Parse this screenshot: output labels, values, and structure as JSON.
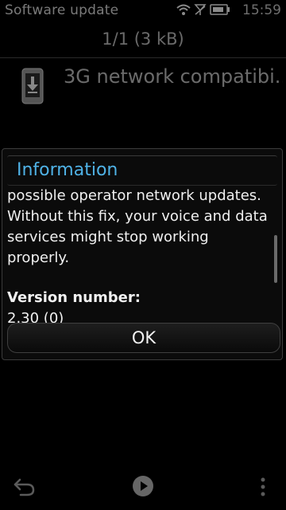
{
  "statusbar": {
    "title": "Software update",
    "time": "15:59",
    "icons": [
      "wifi-icon",
      "signal-off-icon",
      "battery-icon"
    ]
  },
  "header": {
    "title": "1/1 (3 kB)"
  },
  "list": {
    "items": [
      {
        "label": "3G network compatibi...",
        "icon": "download-phone-icon"
      }
    ]
  },
  "dialog": {
    "title": "Information",
    "body_lines": [
      "possible operator network updates.",
      "Without this fix, your voice and data",
      "services might stop working properly."
    ],
    "version_label": "Version number:",
    "version_value": "2.30 (0)",
    "ok_label": "OK"
  },
  "toolbar": {
    "icons": [
      "back-arrow-icon",
      "play-icon",
      "options-menu-icon"
    ]
  },
  "colors": {
    "accent": "#4fb2e6",
    "background": "#000000",
    "muted_text": "#6b6b6b"
  }
}
